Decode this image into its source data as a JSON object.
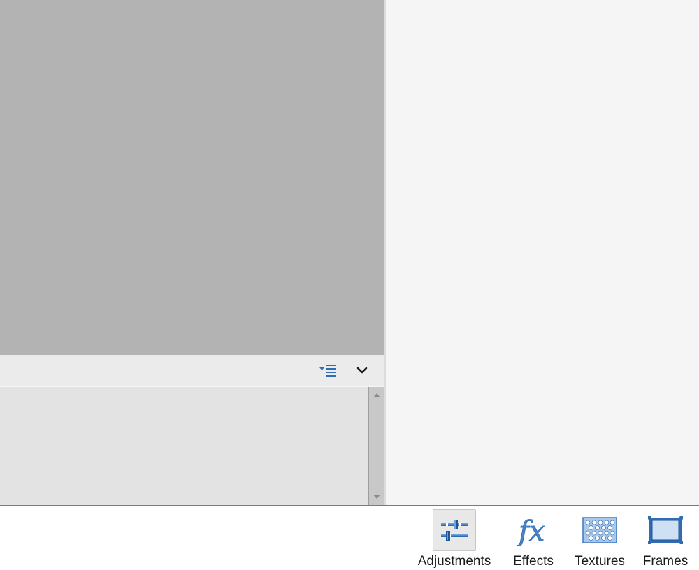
{
  "toolbar": {
    "adjustments_label": "Adjustments",
    "effects_label": "Effects",
    "textures_label": "Textures",
    "frames_label": "Frames",
    "active_tool": "adjustments"
  },
  "icons": {
    "sort": "sort-list-icon",
    "collapse": "chevron-down-icon",
    "scroll_up": "scroll-up-arrow-icon",
    "scroll_down": "scroll-down-arrow-icon",
    "adjustments": "sliders-icon",
    "effects": "fx-icon",
    "textures": "texture-pattern-icon",
    "frames": "frame-icon"
  },
  "colors": {
    "accent": "#2f6db3",
    "canvas": "#b3b3b3",
    "panel": "#f5f5f5"
  }
}
